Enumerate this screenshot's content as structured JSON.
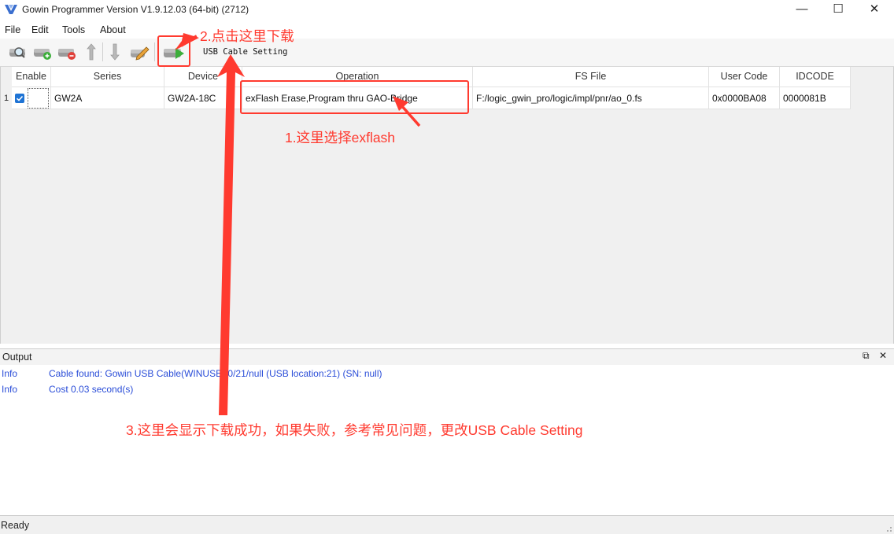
{
  "window": {
    "title": "Gowin Programmer Version V1.9.12.03 (64-bit) (2712)",
    "minimize_glyph": "—",
    "maximize_glyph": "☐",
    "close_glyph": "✕"
  },
  "menu": [
    "File",
    "Edit",
    "Tools",
    "About"
  ],
  "toolbar": {
    "buttons": [
      "scan-device-icon",
      "add-device-icon",
      "remove-device-icon",
      "move-up-icon",
      "move-down-icon",
      "edit-operation-icon",
      "program-run-icon"
    ],
    "usb_cable_setting": "USB Cable Setting"
  },
  "table": {
    "headers": [
      "Enable",
      "Series",
      "Device",
      "Operation",
      "FS File",
      "User Code",
      "IDCODE"
    ],
    "rows": [
      {
        "index": "1",
        "enabled": true,
        "series": "GW2A",
        "device": "GW2A-18C",
        "operation": "exFlash Erase,Program thru GAO-Bridge",
        "fs_file": "F:/logic_gwin_pro/logic/impl/pnr/ao_0.fs",
        "user_code": "0x0000BA08",
        "idcode": "0000081B"
      }
    ]
  },
  "output": {
    "title": "Output",
    "float_glyph": "⧉",
    "close_glyph": "✕",
    "logs": [
      {
        "type": "Info",
        "message": "Cable found:  Gowin USB Cable(WINUSB)/0/21/null (USB location:21) (SN: null)"
      },
      {
        "type": "Info",
        "message": "Cost 0.03 second(s)"
      }
    ]
  },
  "status": "Ready",
  "annotations": {
    "step1": "1.这里选择exflash",
    "step2": "2.点击这里下载",
    "step3": "3.这里会显示下载成功，如果失败，参考常见问题，更改USB Cable Setting"
  },
  "colors": {
    "annotation": "#ff3a2f",
    "log_text": "#2a4dd8",
    "checkbox": "#1e73d4",
    "toolbar_green": "#3cae3a"
  }
}
